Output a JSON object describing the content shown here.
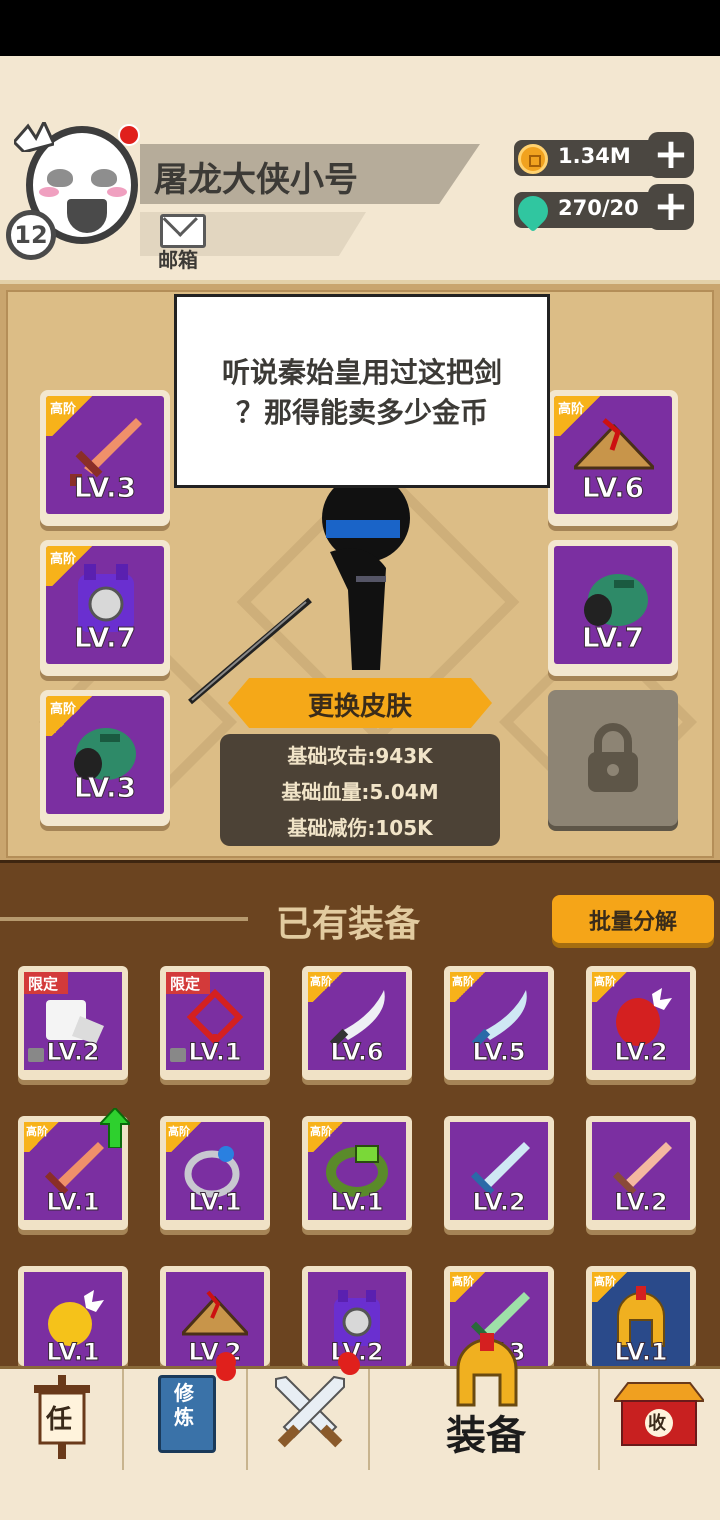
{
  "header": {
    "player_name": "屠龙大侠小号",
    "level": "12",
    "mail_label": "邮箱",
    "currencies": [
      {
        "icon": "coin-icon",
        "value": "1.34M"
      },
      {
        "icon": "gem-icon",
        "value": "270/20"
      }
    ]
  },
  "stage": {
    "speech_text": "听说秦始皇用过这把剑？那得能卖多少金币",
    "speech_line1": "听说秦始皇用过这把剑",
    "speech_line2": "？那得能卖多少金币",
    "change_skin_label": "更换皮肤",
    "stats": {
      "attack": "基础攻击:943K",
      "hp": "基础血量:5.04M",
      "defense": "基础减伤:105K"
    },
    "equipped": [
      {
        "tag": "高阶",
        "level": "LV.3",
        "icon": "sword-icon"
      },
      {
        "tag": "高阶",
        "level": "LV.7",
        "icon": "armor-icon"
      },
      {
        "tag": "高阶",
        "level": "LV.3",
        "icon": "bracer-icon"
      },
      {
        "tag": "高阶",
        "level": "LV.6",
        "icon": "straw-hat-icon"
      },
      {
        "tag": "",
        "level": "LV.7",
        "icon": "bracer-icon"
      }
    ],
    "locked_slot_icon": "padlock-icon"
  },
  "inventory": {
    "title": "已有装备",
    "batch_button": "批量分解",
    "items": [
      {
        "tag": "限定",
        "level": "LV.2",
        "icon": "scroll-icon",
        "locked": true
      },
      {
        "tag": "限定",
        "level": "LV.1",
        "icon": "knot-icon",
        "locked": true
      },
      {
        "tag": "高阶",
        "level": "LV.6",
        "icon": "blade-icon"
      },
      {
        "tag": "高阶",
        "level": "LV.5",
        "icon": "blade-icon"
      },
      {
        "tag": "高阶",
        "level": "LV.2",
        "icon": "gauntlet-icon"
      },
      {
        "tag": "高阶",
        "level": "LV.1",
        "icon": "sword-icon",
        "upgrade": true
      },
      {
        "tag": "高阶",
        "level": "LV.1",
        "icon": "ring-icon"
      },
      {
        "tag": "高阶",
        "level": "LV.1",
        "icon": "bracelet-icon"
      },
      {
        "tag": "",
        "level": "LV.2",
        "icon": "sword-icon"
      },
      {
        "tag": "",
        "level": "LV.2",
        "icon": "sword-icon"
      },
      {
        "tag": "",
        "level": "LV.1",
        "icon": "gauntlet-icon"
      },
      {
        "tag": "",
        "level": "LV.2",
        "icon": "straw-hat-icon"
      },
      {
        "tag": "",
        "level": "LV.2",
        "icon": "armor-icon"
      },
      {
        "tag": "高阶",
        "level": "LV.3",
        "icon": "sword-icon"
      },
      {
        "tag": "高阶",
        "level": "LV.1",
        "icon": "helmet-icon"
      }
    ]
  },
  "nav": {
    "tabs": [
      {
        "label": "任",
        "icon": "scroll-sign-icon"
      },
      {
        "label": "修炼",
        "icon": "book-icon"
      },
      {
        "label": "",
        "icon": "crossed-swords-icon"
      },
      {
        "label": "装备",
        "icon": "helmet-icon"
      },
      {
        "label": "收",
        "icon": "shop-icon"
      }
    ]
  },
  "colors": {
    "accent": "#f5a818",
    "rare_bg": "#7b2fa1",
    "panel_brown": "#6b4420",
    "cream": "#f3e7d1"
  }
}
